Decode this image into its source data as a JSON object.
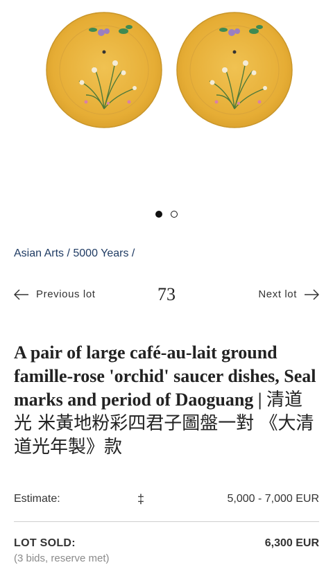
{
  "gallery": {
    "image_count": 2,
    "active_index": 0,
    "dish_color": "#e8b43c"
  },
  "breadcrumb": {
    "text": "Asian Arts / 5000 Years /"
  },
  "lot_nav": {
    "previous_label": "Previous lot",
    "lot_number": "73",
    "next_label": "Next lot"
  },
  "lot": {
    "title_en": "A pair of large café-au-lait ground famille-rose 'orchid' saucer dishes, Seal marks and period of Daoguang | ",
    "title_zh": "清道光 米黃地粉彩四君子圖盤一對 《大清道光年製》款"
  },
  "estimate": {
    "label": "Estimate:",
    "icon": "‡",
    "value": "5,000 - 7,000 EUR"
  },
  "result": {
    "label": "LOT SOLD:",
    "value": "6,300 EUR",
    "note": "(3 bids, reserve met)"
  }
}
